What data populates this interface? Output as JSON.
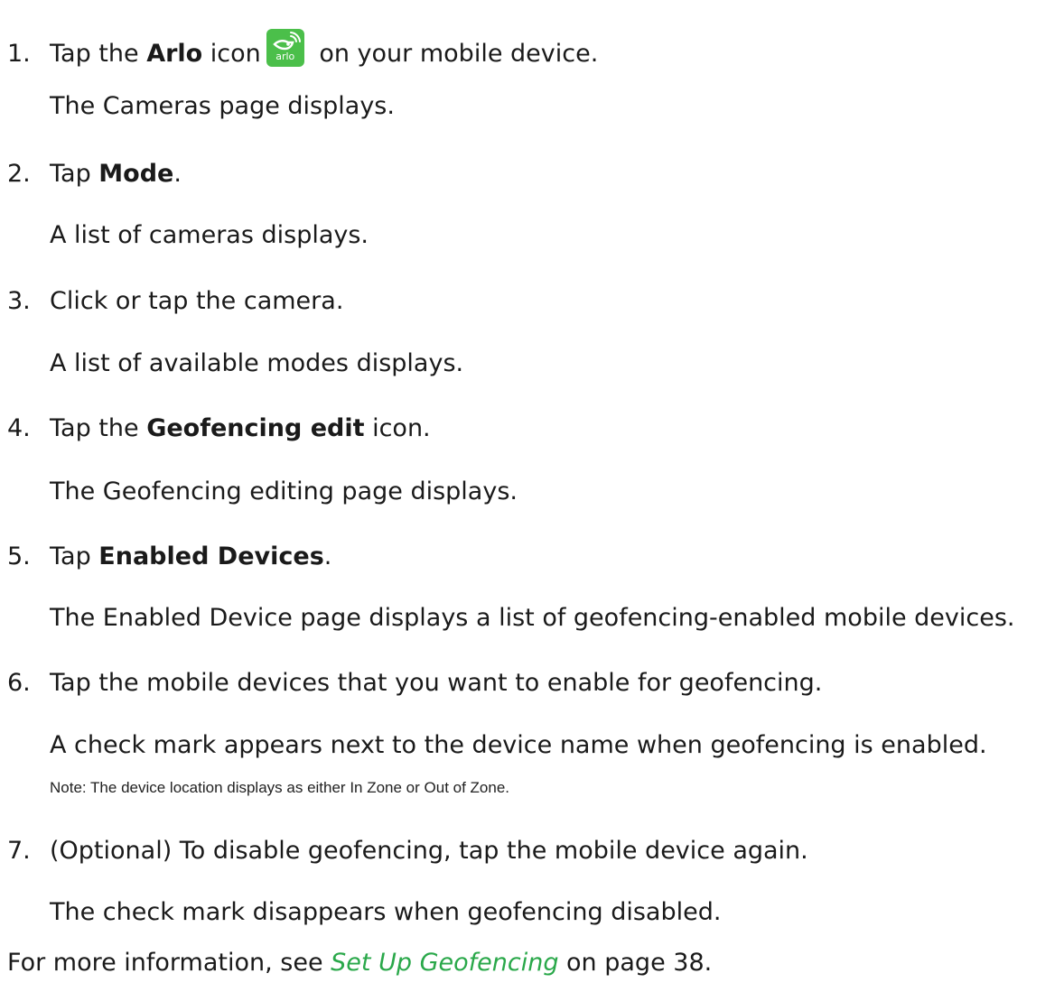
{
  "steps": [
    {
      "number": "1.",
      "pre": "Tap the ",
      "bold": "Arlo",
      "post_before_icon": " icon",
      "post": " on your mobile device.",
      "result": "The Cameras page displays."
    },
    {
      "number": "2.",
      "pre": "Tap ",
      "bold": "Mode",
      "post": ".",
      "result": "A list of cameras displays."
    },
    {
      "number": "3.",
      "text": "Click or tap the camera.",
      "result": "A list of available modes displays."
    },
    {
      "number": "4.",
      "pre": "Tap the ",
      "bold": "Geofencing edit",
      "post": " icon.",
      "result": "The Geofencing editing page displays."
    },
    {
      "number": "5.",
      "pre": "Tap ",
      "bold": "Enabled Devices",
      "post": ".",
      "result": "The Enabled Device page displays a list of geofencing-enabled mobile devices."
    },
    {
      "number": "6.",
      "text": "Tap the mobile devices that you want to enable for geofencing.",
      "result": "A check mark appears next to the device name when geofencing is enabled.",
      "note": "Note: The device location displays as either In Zone or Out of Zone."
    },
    {
      "number": "7.",
      "text": "(Optional) To disable geofencing, tap the mobile device again.",
      "result": "The check mark disappears when geofencing disabled."
    }
  ],
  "arlo_icon": {
    "name": "arlo-app-icon",
    "word": "arlo",
    "color": "#4bbf4a"
  },
  "footer": {
    "pre": "For more information, see ",
    "link": "Set Up Geofencing",
    "post": " on page 38.",
    "link_color": "#2aa84a"
  }
}
